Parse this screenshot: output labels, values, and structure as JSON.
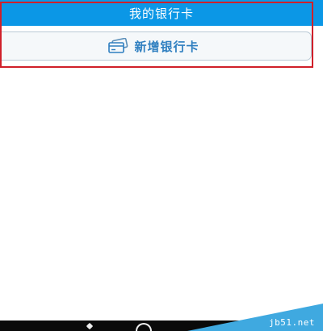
{
  "header": {
    "title": "我的银行卡"
  },
  "actions": {
    "add_card_label": "新增银行卡"
  },
  "watermark": {
    "text": "jb51.net"
  },
  "colors": {
    "header_bg": "#0b97e6",
    "highlight_border": "#d0202a",
    "button_text": "#2f7fc0",
    "button_border": "#b9cad6",
    "watermark_bg": "#3fa9e0"
  },
  "icons": {
    "add_card": "bank-card-icon"
  }
}
